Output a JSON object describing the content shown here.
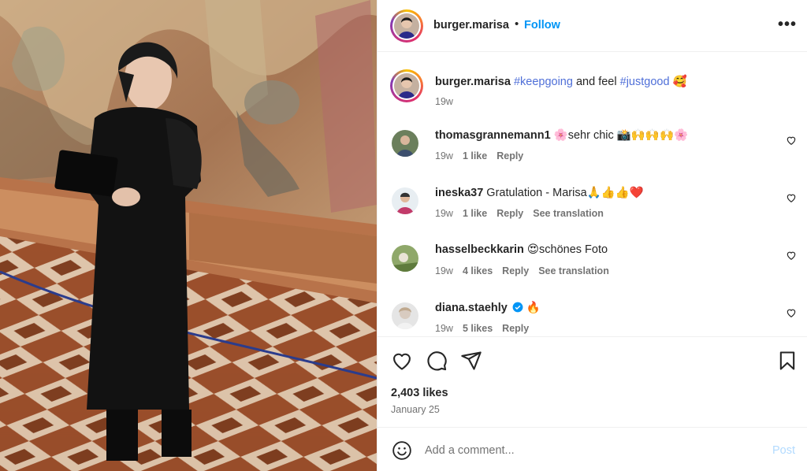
{
  "post": {
    "username": "burger.marisa",
    "dot": "•",
    "follow_label": "Follow",
    "more_label": "•••",
    "image_alt": "woman in black dress standing in front of a tapestry"
  },
  "caption": {
    "username": "burger.marisa",
    "hashtag1": "#keepgoing",
    "middle": " and feel ",
    "hashtag2": "#justgood",
    "emoji": " 🥰",
    "time": "19w"
  },
  "comments": [
    {
      "username": "thomasgrannemann1",
      "text": " 🌸sehr chic 📸🙌🙌🙌🌸",
      "time": "19w",
      "likes": "1 like",
      "reply": "Reply",
      "translation": ""
    },
    {
      "username": "ineska37",
      "text": " Gratulation - Marisa🙏👍👍❤️",
      "time": "19w",
      "likes": "1 like",
      "reply": "Reply",
      "translation": "See translation"
    },
    {
      "username": "hasselbeckkarin",
      "text": " 😍schönes Foto",
      "time": "19w",
      "likes": "4 likes",
      "reply": "Reply",
      "translation": "See translation"
    },
    {
      "username": "diana.staehly",
      "text": " 🔥",
      "time": "19w",
      "likes": "5 likes",
      "reply": "Reply",
      "translation": ""
    }
  ],
  "stats": {
    "likes": "2,403 likes",
    "date": "January 25"
  },
  "add_comment": {
    "placeholder": "Add a comment...",
    "post_label": "Post"
  },
  "icons": {
    "like": "heart-icon",
    "comment": "comment-bubble-icon",
    "share": "send-icon",
    "save": "bookmark-icon",
    "emoji": "smiley-icon",
    "verified": "verified-badge-icon"
  },
  "colors": {
    "accent": "#0095f6",
    "hashtag": "#4f6fd8",
    "muted": "#737373",
    "post_disabled": "#b3dbff",
    "verified": "#0095f6"
  }
}
